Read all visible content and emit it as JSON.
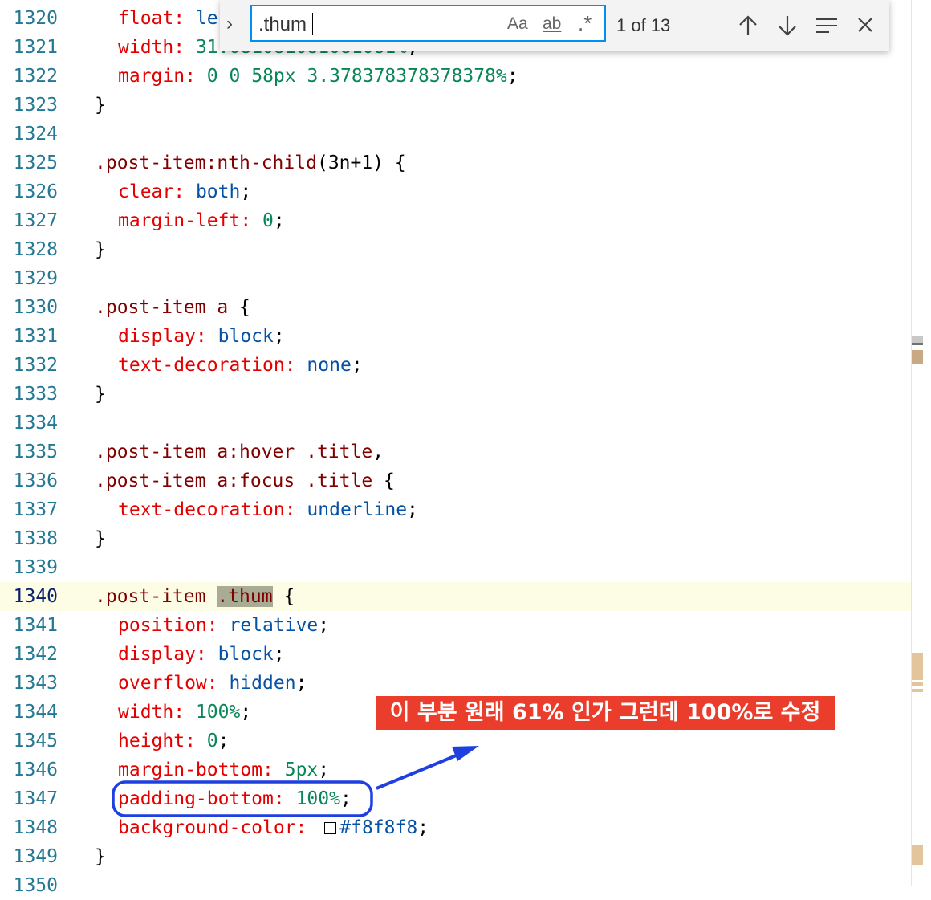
{
  "find_widget": {
    "query": ".thum",
    "match_case_label": "Aa",
    "whole_word_label": "ab",
    "regex_label": ".*",
    "match_count": "1 of 13"
  },
  "lines": [
    {
      "n": "1320",
      "code": "float: le"
    },
    {
      "n": "1321",
      "code": "width: 31.081081081081081%;"
    },
    {
      "n": "1322",
      "code": "margin: 0 0 58px 3.378378378378378%;"
    },
    {
      "n": "1323",
      "code": "}"
    },
    {
      "n": "1324",
      "code": ""
    },
    {
      "n": "1325",
      "code": ".post-item:nth-child(3n+1) {"
    },
    {
      "n": "1326",
      "code": "clear: both;"
    },
    {
      "n": "1327",
      "code": "margin-left: 0;"
    },
    {
      "n": "1328",
      "code": "}"
    },
    {
      "n": "1329",
      "code": ""
    },
    {
      "n": "1330",
      "code": ".post-item a {"
    },
    {
      "n": "1331",
      "code": "display: block;"
    },
    {
      "n": "1332",
      "code": "text-decoration: none;"
    },
    {
      "n": "1333",
      "code": "}"
    },
    {
      "n": "1334",
      "code": ""
    },
    {
      "n": "1335",
      "code": ".post-item a:hover .title,"
    },
    {
      "n": "1336",
      "code": ".post-item a:focus .title {"
    },
    {
      "n": "1337",
      "code": "text-decoration: underline;"
    },
    {
      "n": "1338",
      "code": "}"
    },
    {
      "n": "1339",
      "code": ""
    },
    {
      "n": "1340",
      "code": ".post-item .thum {"
    },
    {
      "n": "1341",
      "code": "position: relative;"
    },
    {
      "n": "1342",
      "code": "display: block;"
    },
    {
      "n": "1343",
      "code": "overflow: hidden;"
    },
    {
      "n": "1344",
      "code": "width: 100%;"
    },
    {
      "n": "1345",
      "code": "height: 0;"
    },
    {
      "n": "1346",
      "code": "margin-bottom: 5px;"
    },
    {
      "n": "1347",
      "code": "padding-bottom: 100%;"
    },
    {
      "n": "1348",
      "code": "background-color: #f8f8f8;"
    },
    {
      "n": "1349",
      "code": "}"
    },
    {
      "n": "1350",
      "code": ""
    }
  ],
  "annotation": {
    "text": "이 부분 원래 61% 인가 그런데 100%로 수정",
    "color": "#ea3d2b",
    "arrow_color": "#1f3fe0"
  }
}
